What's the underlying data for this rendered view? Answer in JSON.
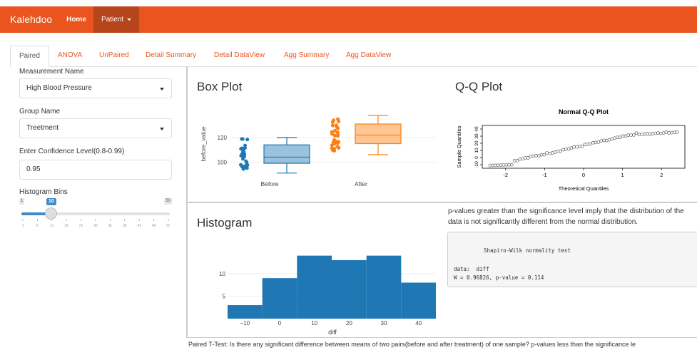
{
  "navbar": {
    "brand": "Kalehdoo",
    "items": [
      {
        "label": "Home"
      },
      {
        "label": "Patient"
      }
    ]
  },
  "tabs": [
    {
      "label": "Paired",
      "active": true
    },
    {
      "label": "ANOVA"
    },
    {
      "label": "UnPaired"
    },
    {
      "label": "Detail Summary"
    },
    {
      "label": "Detail DataView"
    },
    {
      "label": "Agg Summary"
    },
    {
      "label": "Agg DataView"
    }
  ],
  "sidebar": {
    "measurement": {
      "label": "Measurement Name",
      "value": "High Blood Pressure"
    },
    "group": {
      "label": "Group Name",
      "value": "Treetment"
    },
    "confidence": {
      "label": "Enter Confidence Level(0.8-0.99)",
      "value": "0.95"
    },
    "bins": {
      "label": "Histogram Bins",
      "min": "1",
      "max": "50",
      "value": "10",
      "ticks": [
        "1",
        "6",
        "11",
        "16",
        "21",
        "26",
        "31",
        "36",
        "41",
        "46",
        "50"
      ]
    }
  },
  "boxplot": {
    "title": "Box Plot",
    "ylabel": "before_value",
    "yticks": [
      "100",
      "120"
    ],
    "categories": [
      "Before",
      "After"
    ],
    "colors": {
      "Before": "#1f77b4",
      "After": "#ff7f0e"
    }
  },
  "qqplot": {
    "title": "Q-Q Plot",
    "chart_title": "Normal Q-Q Plot",
    "xlabel": "Theoretical Quantiles",
    "ylabel": "Sample Quantiles",
    "xticks": [
      "-2",
      "-1",
      "0",
      "1",
      "2"
    ],
    "yticks": [
      "-10",
      "0",
      "10",
      "20",
      "30",
      "40"
    ]
  },
  "histogram": {
    "title": "Histogram",
    "xlabel": "diff",
    "xticks": [
      "−10",
      "0",
      "10",
      "20",
      "30",
      "40"
    ],
    "yticks": [
      "5",
      "10"
    ],
    "color": "#1f77b4"
  },
  "normality": {
    "note": "p-values greater than the significance level imply that the distribution of the data is not significantly different from the normal distribution.",
    "test_title": "Shapiro-Wilk normality test",
    "data_line": "data:  diff",
    "result_line": "W = 0.96826, p-value = 0.114"
  },
  "footer_note": "Paired T-Test: Is there any significant difference between means of two pairs(before and after treatment) of one sample? p-values less than the significance le",
  "chart_data": [
    {
      "type": "box",
      "title": "Box Plot",
      "ylabel": "before_value",
      "categories": [
        "Before",
        "After"
      ],
      "series": [
        {
          "name": "Before",
          "min": 91,
          "q1": 99,
          "median": 104,
          "q3": 114,
          "max": 120
        },
        {
          "name": "After",
          "min": 106,
          "q1": 115,
          "median": 122,
          "q3": 131,
          "max": 138
        }
      ],
      "ylim": [
        88,
        142
      ]
    },
    {
      "type": "scatter",
      "title": "Normal Q-Q Plot",
      "xlabel": "Theoretical Quantiles",
      "ylabel": "Sample Quantiles",
      "xlim": [
        -2.6,
        2.6
      ],
      "ylim": [
        -15,
        45
      ]
    },
    {
      "type": "bar",
      "title": "",
      "xlabel": "diff",
      "categories": [
        "-15–-5",
        "-5–5",
        "5–15",
        "15–25",
        "25–35",
        "35–45"
      ],
      "values": [
        3,
        9,
        14,
        13,
        14,
        8
      ],
      "xlim": [
        -15,
        45
      ],
      "ylim": [
        0,
        16
      ]
    }
  ]
}
